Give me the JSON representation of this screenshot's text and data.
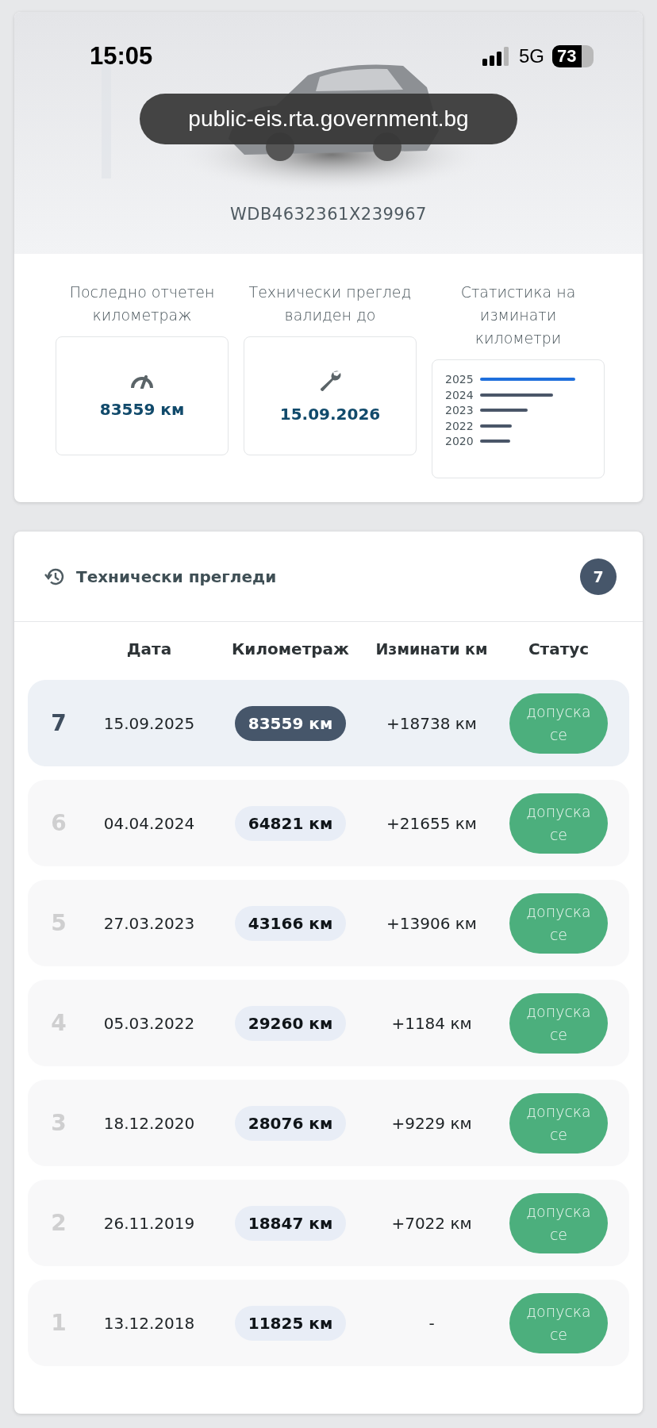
{
  "status_bar": {
    "time": "15:05",
    "network": "5G",
    "battery": "73"
  },
  "address_bar": {
    "url": "public-eis.rta.government.bg"
  },
  "vehicle": {
    "kind": "picture",
    "vin": "WDB4632361X239967"
  },
  "summary": [
    {
      "kind": "mileage",
      "label": "Последно отчетен километраж",
      "value": "83559 км"
    },
    {
      "kind": "validity",
      "label": "Технически преглед валиден до",
      "value": "15.09.2026"
    },
    {
      "kind": "stats",
      "label": "Статистика на изминати километри",
      "bars": [
        {
          "year": "2025"
        },
        {
          "year": "2024"
        },
        {
          "year": "2023"
        },
        {
          "year": "2022"
        },
        {
          "year": "2020"
        }
      ]
    }
  ],
  "inspections": {
    "title": "Технически прегледи",
    "count": "7",
    "columns": [
      "Дата",
      "Километраж",
      "Изминати км",
      "Статус"
    ],
    "rows": [
      {
        "number": "7",
        "date": "15.09.2025",
        "mileage": "83559 км",
        "difference": "+18738 км",
        "status": "допуска се",
        "selected": true
      },
      {
        "number": "6",
        "date": "04.04.2024",
        "mileage": "64821 км",
        "difference": "+21655 км",
        "status": "допуска се",
        "selected": false
      },
      {
        "number": "5",
        "date": "27.03.2023",
        "mileage": "43166 км",
        "difference": "+13906 км",
        "status": "допуска се",
        "selected": false
      },
      {
        "number": "4",
        "date": "05.03.2022",
        "mileage": "29260 км",
        "difference": "+1184 км",
        "status": "допуска се",
        "selected": false
      },
      {
        "number": "3",
        "date": "18.12.2020",
        "mileage": "28076 км",
        "difference": "+9229 км",
        "status": "допуска се",
        "selected": false
      },
      {
        "number": "2",
        "date": "26.11.2019",
        "mileage": "18847 км",
        "difference": "+7022 км",
        "status": "допуска се",
        "selected": false
      },
      {
        "number": "1",
        "date": "13.12.2018",
        "mileage": "11825 км",
        "difference": "-",
        "status": "допуска се",
        "selected": false
      }
    ]
  }
}
